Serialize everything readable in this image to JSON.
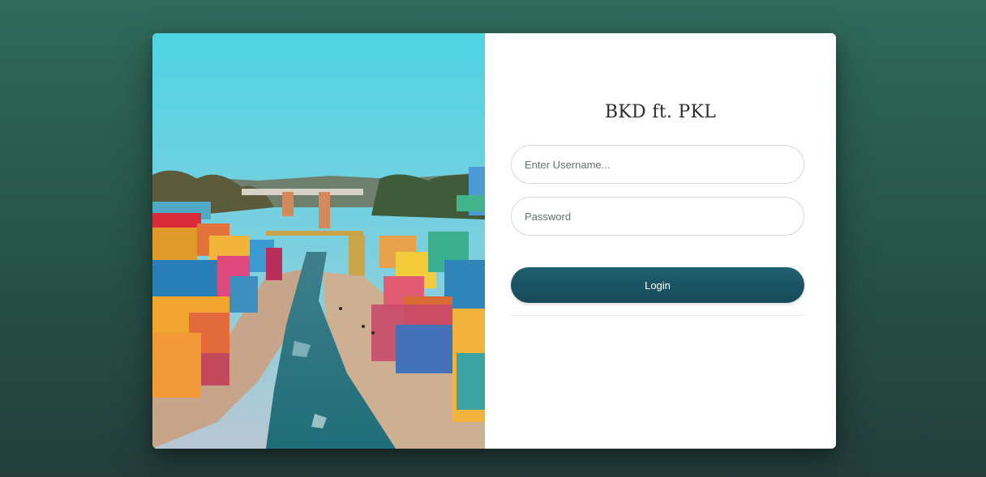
{
  "app": {
    "title": "BKD ft. PKL"
  },
  "form": {
    "username_placeholder": "Enter Username...",
    "username_value": "",
    "password_placeholder": "Password",
    "password_value": "",
    "login_label": "Login"
  },
  "colors": {
    "background_top": "#2f6a5b",
    "background_bottom": "#243d3a",
    "button": "#1a5564",
    "card": "#ffffff"
  }
}
